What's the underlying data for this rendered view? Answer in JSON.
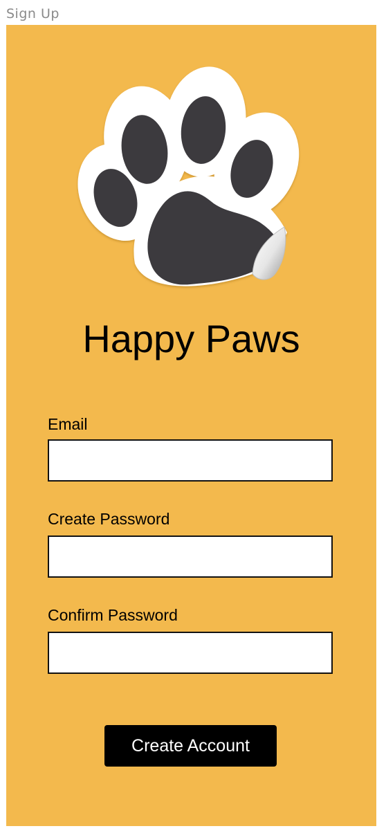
{
  "frame": {
    "title": "Sign Up"
  },
  "app": {
    "name": "Happy Paws",
    "logo_icon": "paw-print-sticker-icon"
  },
  "form": {
    "email_label": "Email",
    "email_value": "",
    "create_password_label": "Create Password",
    "create_password_value": "",
    "confirm_password_label": "Confirm Password",
    "confirm_password_value": "",
    "submit_label": "Create Account"
  },
  "colors": {
    "background": "#F3B94D",
    "paw": "#3C3A3E",
    "button": "#000000",
    "button_text": "#FFFFFF"
  }
}
